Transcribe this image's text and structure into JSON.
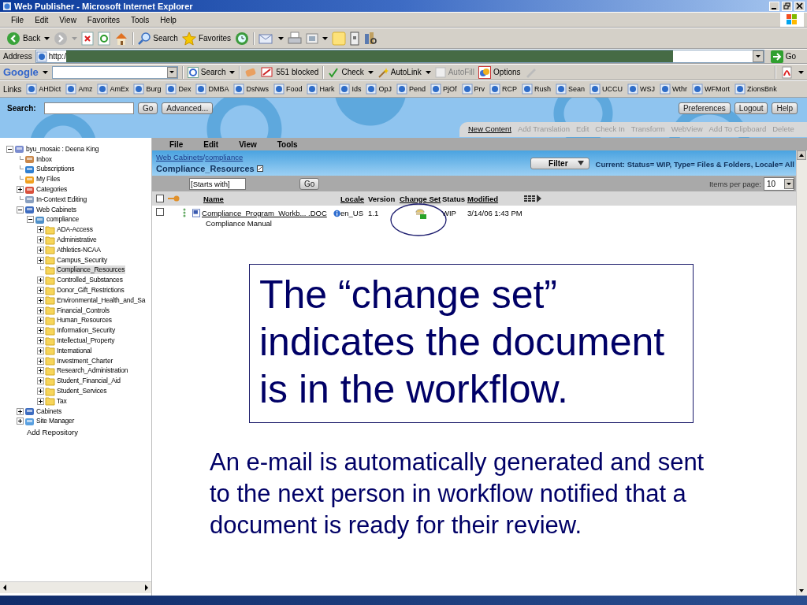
{
  "window": {
    "title": "Web Publisher - Microsoft Internet Explorer"
  },
  "menu": [
    "File",
    "Edit",
    "View",
    "Favorites",
    "Tools",
    "Help"
  ],
  "toolbar": {
    "back": "Back",
    "search": "Search",
    "favorites": "Favorites"
  },
  "address": {
    "label": "Address",
    "value": "http:/",
    "go": "Go"
  },
  "google_bar": {
    "logo": "Google",
    "search": "Search",
    "blocked": "551 blocked",
    "check": "Check",
    "autolink": "AutoLink",
    "autofill": {
      "label": "AutoFill",
      "disabled": true
    },
    "options": "Options"
  },
  "links": {
    "label": "Links",
    "items": [
      "AHDict",
      "Amz",
      "AmEx",
      "Burg",
      "Dex",
      "DMBA",
      "DsNws",
      "Food",
      "Hark",
      "Ids",
      "OpJ",
      "Pend",
      "PjOf",
      "Prv",
      "RCP",
      "Rush",
      "Sean",
      "UCCU",
      "WSJ",
      "Wthr",
      "WFMort",
      "ZionsBnk"
    ]
  },
  "header": {
    "search_label": "Search:",
    "go": "Go",
    "advanced": "Advanced...",
    "buttons": [
      "Preferences",
      "Logout",
      "Help"
    ],
    "actions": [
      {
        "label": "New Content",
        "disabled": false
      },
      {
        "label": "Add Translation",
        "disabled": true
      },
      {
        "label": "Edit",
        "disabled": true
      },
      {
        "label": "Check In",
        "disabled": true
      },
      {
        "label": "Transform",
        "disabled": true
      },
      {
        "label": "WebView",
        "disabled": true
      },
      {
        "label": "Add To Clipboard",
        "disabled": true
      },
      {
        "label": "Delete",
        "disabled": true
      }
    ]
  },
  "tree": [
    {
      "label": "byu_mosaic : Deena King",
      "kind": "repository",
      "expanded": true,
      "selected": false,
      "children": [
        {
          "label": "Inbox",
          "kind": "inbox",
          "selected": false
        },
        {
          "label": "Subscriptions",
          "kind": "subscriptions",
          "selected": false
        },
        {
          "label": "My Files",
          "kind": "myfiles",
          "selected": false
        },
        {
          "label": "Categories",
          "kind": "categories",
          "expanded": false,
          "selected": false
        },
        {
          "label": "In-Context Editing",
          "kind": "editing",
          "selected": false
        },
        {
          "label": "Web Cabinets",
          "kind": "cabinets",
          "expanded": true,
          "selected": false,
          "children": [
            {
              "label": "compliance",
              "kind": "cabinet",
              "expanded": true,
              "selected": false,
              "children": [
                {
                  "label": "ADA-Access",
                  "kind": "folder",
                  "expanded": false,
                  "selected": false
                },
                {
                  "label": "Administrative",
                  "kind": "folder",
                  "expanded": false,
                  "selected": false
                },
                {
                  "label": "Athletics-NCAA",
                  "kind": "folder",
                  "expanded": false,
                  "selected": false
                },
                {
                  "label": "Campus_Security",
                  "kind": "folder",
                  "expanded": false,
                  "selected": false
                },
                {
                  "label": "Compliance_Resources",
                  "kind": "folder",
                  "selected": true
                },
                {
                  "label": "Controlled_Substances",
                  "kind": "folder",
                  "expanded": false,
                  "selected": false
                },
                {
                  "label": "Donor_Gift_Restrictions",
                  "kind": "folder",
                  "expanded": false,
                  "selected": false
                },
                {
                  "label": "Environmental_Health_and_Sa",
                  "kind": "folder",
                  "expanded": false,
                  "selected": false
                },
                {
                  "label": "Financial_Controls",
                  "kind": "folder",
                  "expanded": false,
                  "selected": false
                },
                {
                  "label": "Human_Resources",
                  "kind": "folder",
                  "expanded": false,
                  "selected": false
                },
                {
                  "label": "Information_Security",
                  "kind": "folder",
                  "expanded": false,
                  "selected": false
                },
                {
                  "label": "Intellectual_Property",
                  "kind": "folder",
                  "expanded": false,
                  "selected": false
                },
                {
                  "label": "International",
                  "kind": "folder",
                  "expanded": false,
                  "selected": false
                },
                {
                  "label": "Investment_Charter",
                  "kind": "folder",
                  "expanded": false,
                  "selected": false
                },
                {
                  "label": "Research_Administration",
                  "kind": "folder",
                  "expanded": false,
                  "selected": false
                },
                {
                  "label": "Student_Financial_Aid",
                  "kind": "folder",
                  "expanded": false,
                  "selected": false
                },
                {
                  "label": "Student_Services",
                  "kind": "folder",
                  "expanded": false,
                  "selected": false
                },
                {
                  "label": "Tax",
                  "kind": "folder",
                  "expanded": false,
                  "selected": false
                }
              ]
            }
          ]
        },
        {
          "label": "Cabinets",
          "kind": "cabinets",
          "expanded": false,
          "selected": false
        },
        {
          "label": "Site Manager",
          "kind": "site",
          "expanded": false,
          "selected": false
        }
      ]
    }
  ],
  "add_repository": "Add Repository",
  "content": {
    "menu": [
      "File",
      "Edit",
      "View",
      "Tools"
    ],
    "breadcrumb": [
      "Web Cabinets",
      "compliance"
    ],
    "separator": "/",
    "folder_title": "Compliance_Resources",
    "filter_button": "Filter",
    "filter_status": "Current: Status= WIP, Type= Files & Folders, Locale= All",
    "starts_with": "[Starts with]",
    "go": "Go",
    "items_per_page_label": "Items per page:",
    "items_per_page": "10",
    "columns": [
      {
        "label": "Name",
        "sortable": true
      },
      {
        "label": "Locale",
        "sortable": true
      },
      {
        "label": "Version",
        "sortable": false
      },
      {
        "label": "Change Set",
        "sortable": true
      },
      {
        "label": "Status",
        "sortable": false
      },
      {
        "label": "Modified",
        "sortable": true
      }
    ],
    "select_all": false,
    "rows": [
      {
        "checked": false,
        "name": "Compliance_Program_Workb... .DOC",
        "description": "Compliance Manual",
        "locale": "en_US",
        "version": "1.1",
        "status": "WIP",
        "modified": "3/14/06 1:43 PM",
        "in_change_set": true,
        "highlighted": true
      }
    ]
  },
  "callout": "The “change set” indicates the document is in the workflow.",
  "note": "An e-mail is automatically generated and sent to the next person in workflow notified that a document is ready for their review."
}
